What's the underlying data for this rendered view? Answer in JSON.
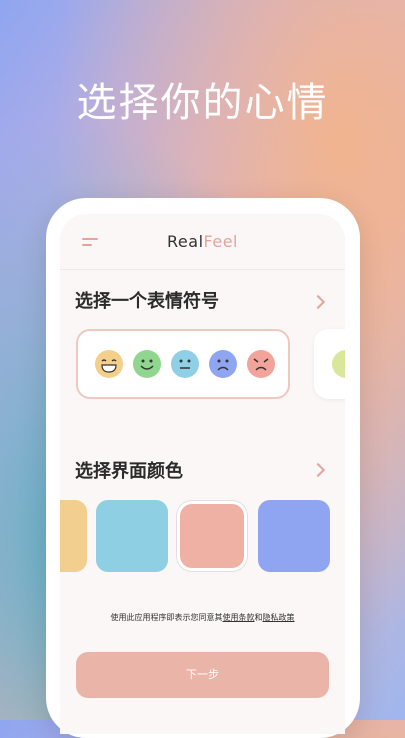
{
  "promo": {
    "title": "选择你的心情"
  },
  "app": {
    "brand_part1": "Real",
    "brand_part2": "Feel"
  },
  "emoji_section": {
    "title": "选择一个表情符号",
    "emojis": [
      {
        "name": "laughing-face-icon",
        "color": "#f3cf8a"
      },
      {
        "name": "smiling-face-icon",
        "color": "#8fd68e"
      },
      {
        "name": "neutral-face-icon",
        "color": "#8fd0e6"
      },
      {
        "name": "sad-face-icon",
        "color": "#8ea6f2"
      },
      {
        "name": "angry-face-icon",
        "color": "#f2a39a"
      }
    ]
  },
  "color_section": {
    "title": "选择界面颜色",
    "swatches": [
      "#f2cf8f",
      "#8fcfe3",
      "#f0b1a5",
      "#8fa5f1"
    ],
    "selected_index": 2
  },
  "footer": {
    "terms_prefix": "使用此应用程序即表示您同意其",
    "terms_link": "使用条款",
    "terms_and": "和",
    "privacy_link": "隐私政策",
    "next_button": "下一步"
  }
}
